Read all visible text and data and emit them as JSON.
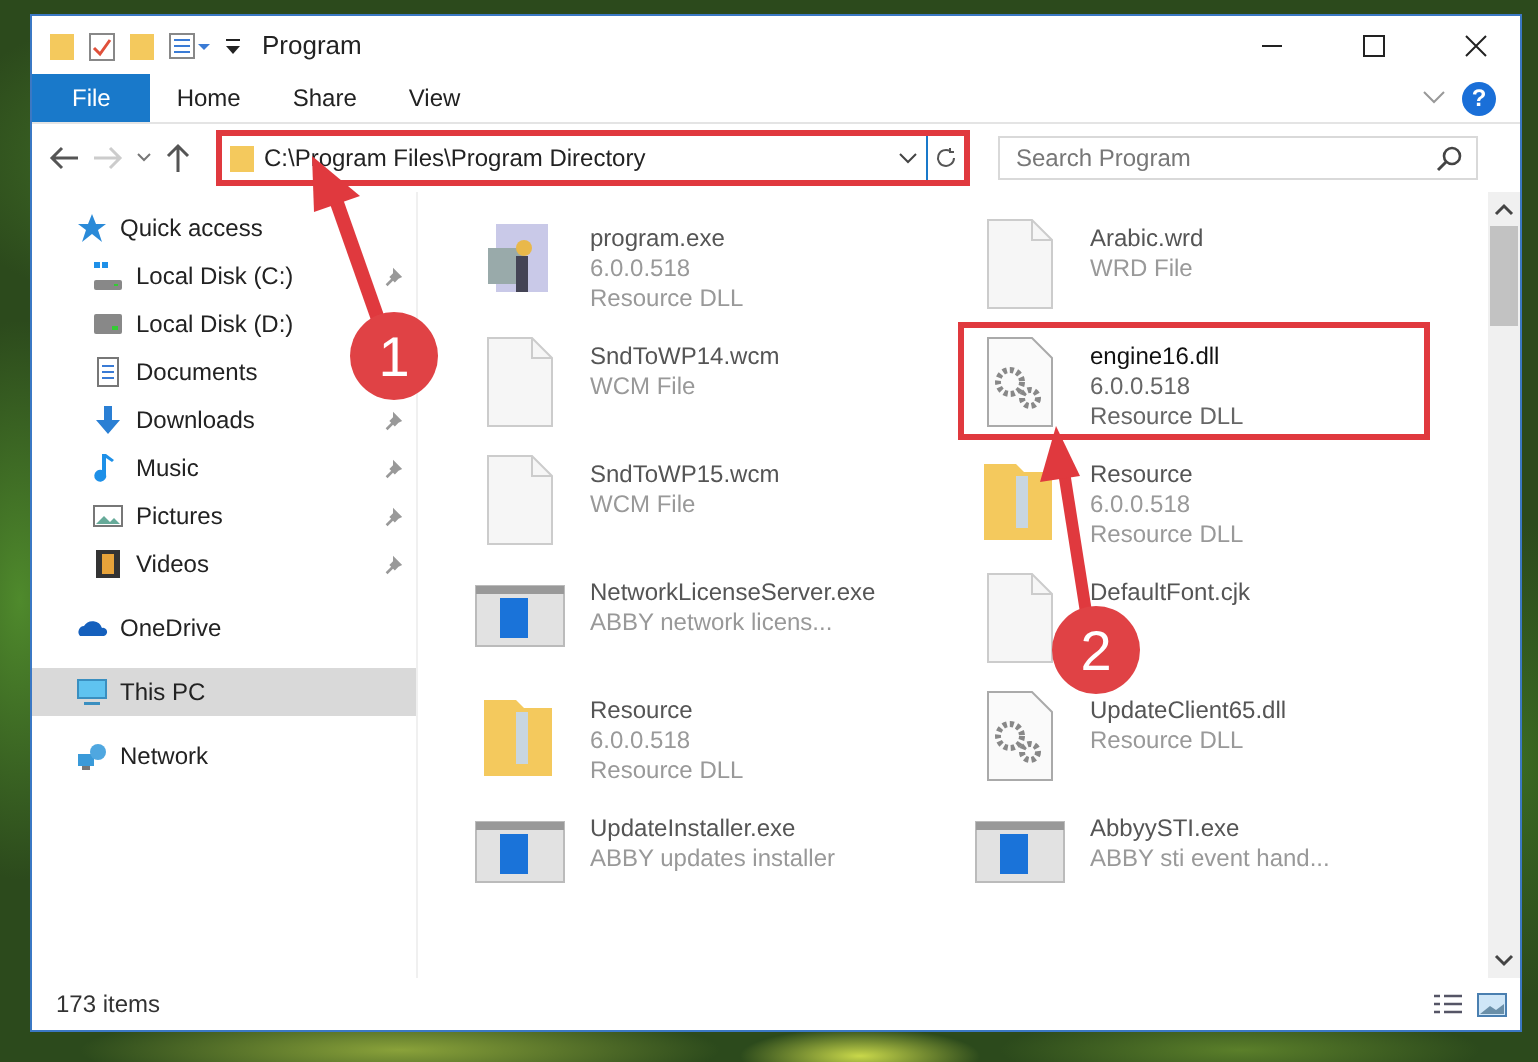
{
  "window": {
    "title": "Program"
  },
  "ribbon": {
    "tabs": [
      {
        "label": "File",
        "selected": true
      },
      {
        "label": "Home",
        "selected": false
      },
      {
        "label": "Share",
        "selected": false
      },
      {
        "label": "View",
        "selected": false
      }
    ],
    "help": "?"
  },
  "address": {
    "path": "C:\\Program Files\\Program Directory",
    "highlighted": true
  },
  "search": {
    "placeholder": "Search Program"
  },
  "sidebar": {
    "items": [
      {
        "label": "Quick access",
        "kind": "star",
        "pinned": false,
        "selected": false,
        "children": [
          {
            "label": "Local Disk (C:)",
            "kind": "disk-win",
            "pinned": true,
            "selected": false
          },
          {
            "label": "Local Disk (D:)",
            "kind": "disk",
            "pinned": false,
            "selected": false
          },
          {
            "label": "Documents",
            "kind": "doc",
            "pinned": false,
            "selected": false
          },
          {
            "label": "Downloads",
            "kind": "download",
            "pinned": true,
            "selected": false
          },
          {
            "label": "Music",
            "kind": "music",
            "pinned": true,
            "selected": false
          },
          {
            "label": "Pictures",
            "kind": "pictures",
            "pinned": true,
            "selected": false
          },
          {
            "label": "Videos",
            "kind": "video",
            "pinned": true,
            "selected": false
          }
        ]
      },
      {
        "label": "OneDrive",
        "kind": "cloud",
        "pinned": false,
        "selected": false
      },
      {
        "label": "This PC",
        "kind": "pc",
        "pinned": false,
        "selected": true
      },
      {
        "label": "Network",
        "kind": "network",
        "pinned": false,
        "selected": false
      }
    ]
  },
  "files": [
    {
      "name": "program.exe",
      "kind": "exe",
      "details": [
        "6.0.0.518",
        "Resource DLL"
      ],
      "highlighted": false
    },
    {
      "name": "Arabic.wrd",
      "kind": "blank",
      "details": [
        "WRD File"
      ],
      "highlighted": false
    },
    {
      "name": "SndToWP14.wcm",
      "kind": "blank",
      "details": [
        "WCM File"
      ],
      "highlighted": false
    },
    {
      "name": "engine16.dll",
      "kind": "dll",
      "details": [
        "6.0.0.518",
        "Resource DLL"
      ],
      "highlighted": true
    },
    {
      "name": "SndToWP15.wcm",
      "kind": "blank",
      "details": [
        "WCM File"
      ],
      "highlighted": false
    },
    {
      "name": "Resource",
      "kind": "folder",
      "details": [
        "6.0.0.518",
        "Resource DLL"
      ],
      "highlighted": false
    },
    {
      "name": "NetworkLicenseServer.exe",
      "kind": "app",
      "details": [
        "ABBY network licens..."
      ],
      "highlighted": false
    },
    {
      "name": "DefaultFont.cjk",
      "kind": "blank",
      "highlighted": false
    },
    {
      "name": "Resource",
      "kind": "folder",
      "details": [
        "6.0.0.518",
        "Resource DLL"
      ],
      "highlighted": false
    },
    {
      "name": "UpdateClient65.dll",
      "kind": "dll",
      "details": [
        "Resource DLL"
      ],
      "highlighted": false
    },
    {
      "name": "UpdateInstaller.exe",
      "kind": "app",
      "details": [
        "ABBY updates installer"
      ],
      "highlighted": false
    },
    {
      "name": "AbbyySTI.exe",
      "kind": "app",
      "details": [
        "ABBY sti event hand..."
      ],
      "highlighted": false
    }
  ],
  "status_bar": {
    "count": "173 items"
  },
  "annotations": [
    {
      "label": "1"
    },
    {
      "label": "2"
    }
  ]
}
